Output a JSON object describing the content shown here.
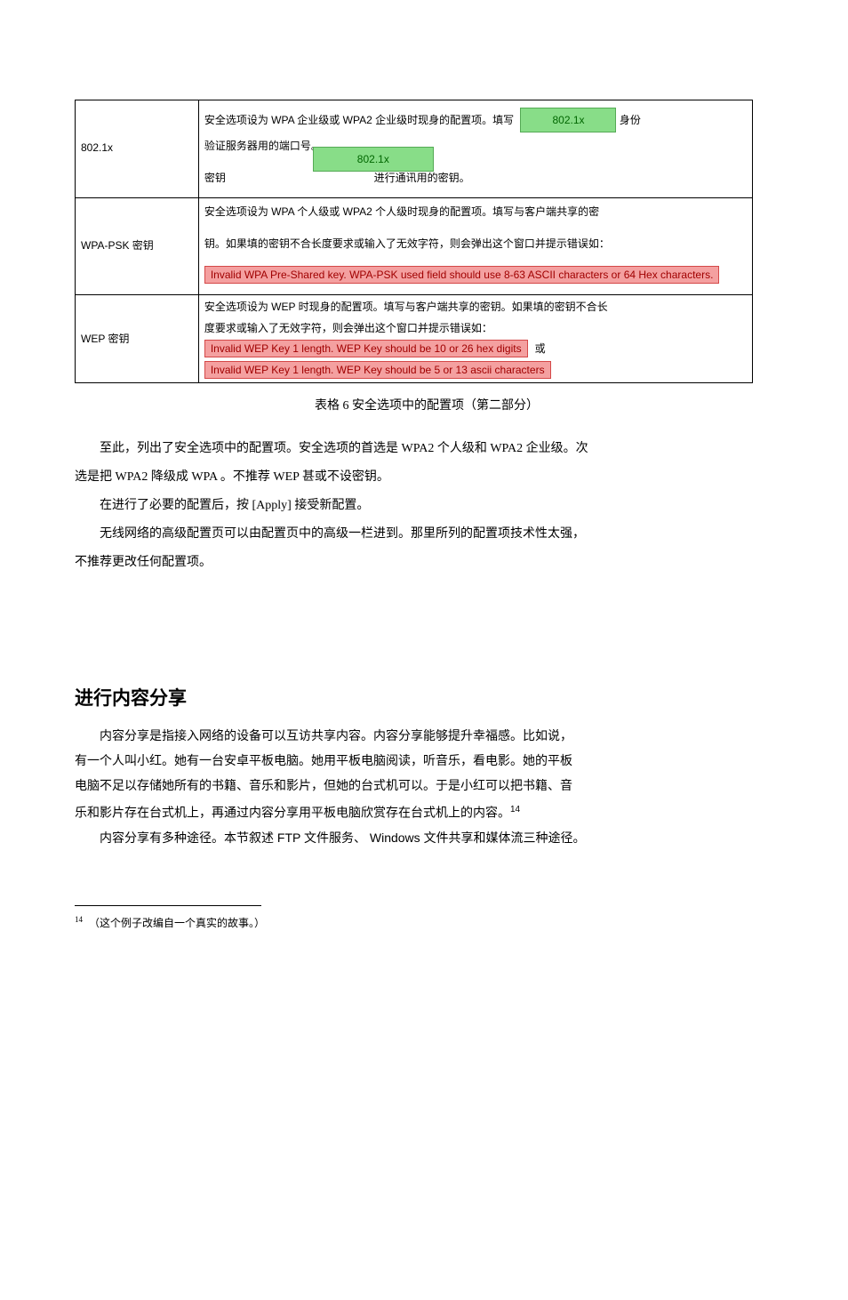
{
  "table": {
    "row1": {
      "left": "802.1x",
      "l1a": "安全选项设为",
      "l1b": "WPA",
      "l1c": "企业级或",
      "l1d": "WPA2",
      "l1e": "企业级时现身的配置项。填写",
      "l2a": "身份",
      "l2b": "验证服务器用的端口号。",
      "btn_right": "802.1x",
      "l3a": "密钥",
      "btn_left": "802.1x",
      "l3b": "进行通讯用的密钥。"
    },
    "row2": {
      "left": "WPA-PSK 密钥",
      "r_a": "安全选项设为",
      "r_b": "WPA",
      "r_c": "个人级或",
      "r_d": "WPA2",
      "r_e": "个人级时现身的配置项。填写与客户端共享的密",
      "r_f": "钥。如果填的密钥不合长度要求或输入了无效字符，则会弹出这个窗口并提示错误如：",
      "red": "Invalid WPA Pre-Shared key. WPA-PSK used field should use 8-63 ASCII characters or 64 Hex characters."
    },
    "row3": {
      "left": "WEP 密钥",
      "r_a": "安全选项设为",
      "r_b": "WEP",
      "r_c": "时现身的配置项。填写与客户端共享的密钥。如果填的密钥不合长",
      "r_f": "度要求或输入了无效字符，则会弹出这个窗口并提示错误如：",
      "red1": "Invalid WEP Key 1 length. WEP Key should be 10 or 26 hex digits",
      "r_or": "或",
      "red2": "Invalid WEP Key 1 length. WEP Key should be 5 or 13 ascii characters"
    },
    "caption_a": "表格",
    "caption_b": "6",
    "caption_c": "  安全选项中的配置项（第二部分）"
  },
  "body": {
    "p1a": "至此，列出了安全选项中的配置项。安全选项的首选是",
    "p1b": "WPA2",
    "p1c": "个人级和",
    "p1d": "WPA2",
    "p1e": "企业级。次",
    "p2a": "选是把",
    "p2b": "WPA2",
    "p2c": "降级成",
    "p2d": "WPA",
    "p2e": "。不推荐",
    "p2f": "WEP",
    "p2g": "甚或不设密钥。",
    "p3a": "在进行了必要的配置后，按",
    "p3b": "[Apply]",
    "p3c": "接受新配置。",
    "p4a": "无线网络的高级配置页可以由配置页中的高级一栏进到。那里所列的配置项技术性太强，",
    "p5a": "不推荐更改任何配置项。"
  },
  "section": {
    "title": "进行内容分享",
    "p1": "内容分享是指接入网络的设备可以互访共享内容。内容分享能够提升幸福感。比如说，",
    "p2": "有一个人叫小红。她有一台安卓平板电脑。她用平板电脑阅读，听音乐，看电影。她的平板",
    "p3": "电脑不足以存储她所有的书籍、音乐和影片，但她的台式机可以。于是小红可以把书籍、音",
    "p4a": "乐和影片存在台式机上，再通过内容分享用平板电脑欣赏存在台式机上的内容。",
    "p4sup": "14",
    "p5a": "内容分享有多种途径。本节叙述",
    "p5b": "FTP",
    "p5c": "文件服务、",
    "p5d": "Windows",
    "p5e": "文件共享和媒体流三种途径。"
  },
  "footnote": {
    "num": "14",
    "text": "  （这个例子改编自一个真实的故事。）"
  }
}
